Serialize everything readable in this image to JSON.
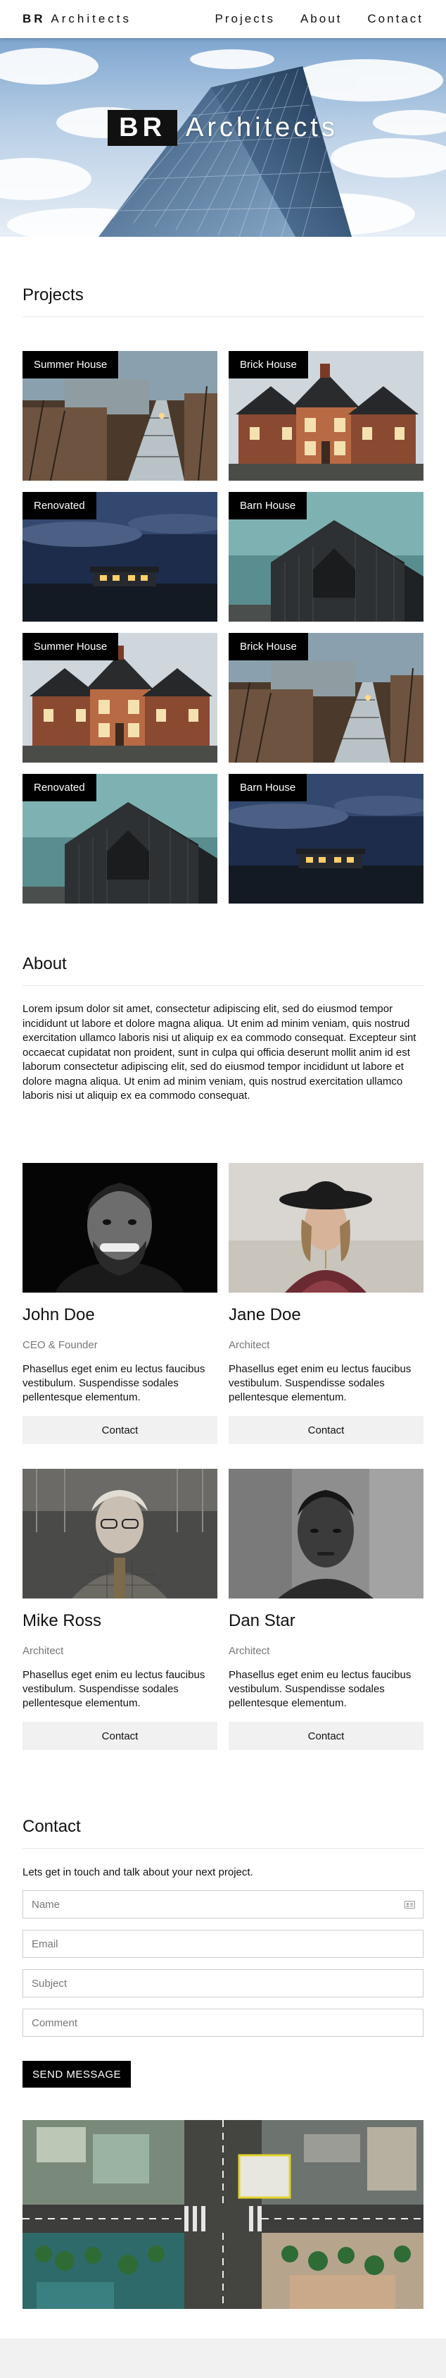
{
  "nav": {
    "brand_bold": "BR",
    "brand_rest": "Architects",
    "links": [
      "Projects",
      "About",
      "Contact"
    ]
  },
  "hero": {
    "badge": "BR",
    "word": "Architects"
  },
  "projects": {
    "title": "Projects",
    "tiles": [
      {
        "label": "Summer House",
        "scene": "boardwalk"
      },
      {
        "label": "Brick House",
        "scene": "brick"
      },
      {
        "label": "Renovated",
        "scene": "night"
      },
      {
        "label": "Barn House",
        "scene": "barn"
      },
      {
        "label": "Summer House",
        "scene": "brick"
      },
      {
        "label": "Brick House",
        "scene": "boardwalk"
      },
      {
        "label": "Renovated",
        "scene": "barn"
      },
      {
        "label": "Barn House",
        "scene": "night"
      }
    ]
  },
  "about": {
    "title": "About",
    "text": "Lorem ipsum dolor sit amet, consectetur adipiscing elit, sed do eiusmod tempor incididunt ut labore et dolore magna aliqua. Ut enim ad minim veniam, quis nostrud exercitation ullamco laboris nisi ut aliquip ex ea commodo consequat. Excepteur sint occaecat cupidatat non proident, sunt in culpa qui officia deserunt mollit anim id est laborum consectetur adipiscing elit, sed do eiusmod tempor incididunt ut labore et dolore magna aliqua. Ut enim ad minim veniam, quis nostrud exercitation ullamco laboris nisi ut aliquip ex ea commodo consequat."
  },
  "team": [
    {
      "name": "John Doe",
      "role": "CEO & Founder",
      "bio": "Phasellus eget enim eu lectus faucibus vestibulum. Suspendisse sodales pellentesque elementum.",
      "button": "Contact"
    },
    {
      "name": "Jane Doe",
      "role": "Architect",
      "bio": "Phasellus eget enim eu lectus faucibus vestibulum. Suspendisse sodales pellentesque elementum.",
      "button": "Contact"
    },
    {
      "name": "Mike Ross",
      "role": "Architect",
      "bio": "Phasellus eget enim eu lectus faucibus vestibulum. Suspendisse sodales pellentesque elementum.",
      "button": "Contact"
    },
    {
      "name": "Dan Star",
      "role": "Architect",
      "bio": "Phasellus eget enim eu lectus faucibus vestibulum. Suspendisse sodales pellentesque elementum.",
      "button": "Contact"
    }
  ],
  "contact": {
    "title": "Contact",
    "intro": "Lets get in touch and talk about your next project.",
    "placeholders": {
      "name": "Name",
      "email": "Email",
      "subject": "Subject",
      "comment": "Comment"
    },
    "send_label": "SEND MESSAGE"
  },
  "icons": {
    "field_autofill": "contact-card-icon"
  },
  "colors": {
    "button_dark": "#000000",
    "button_light": "#f1f1f1",
    "muted_text": "#777777"
  }
}
